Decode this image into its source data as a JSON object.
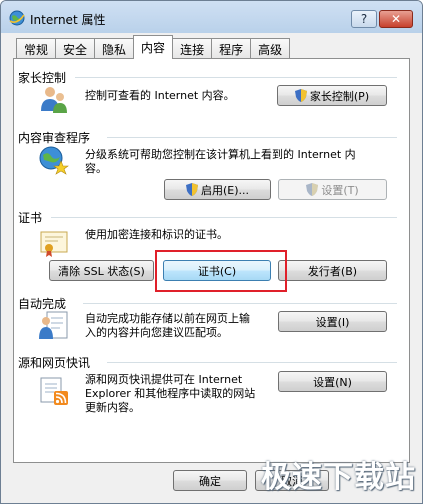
{
  "window": {
    "title": "Internet 属性",
    "help_label": "?",
    "close_label": "✕"
  },
  "tabs": [
    {
      "label": "常规"
    },
    {
      "label": "安全"
    },
    {
      "label": "隐私"
    },
    {
      "label": "内容",
      "active": true
    },
    {
      "label": "连接"
    },
    {
      "label": "程序"
    },
    {
      "label": "高级"
    }
  ],
  "parental": {
    "title": "家长控制",
    "description": "控制可查看的 Internet 内容。",
    "button": "家长控制(P)"
  },
  "advisor": {
    "title": "内容审查程序",
    "description_line1": "分级系统可帮助您控制在该计算机上看到的 Internet 内",
    "description_line2": "容。",
    "enable_button": "启用(E)...",
    "settings_button": "设置(T)"
  },
  "certificates": {
    "title": "证书",
    "description": "使用加密连接和标识的证书。",
    "clear_ssl_button": "清除 SSL 状态(S)",
    "certificates_button": "证书(C)",
    "publishers_button": "发行者(B)"
  },
  "autocomplete": {
    "title": "自动完成",
    "description_line1": "自动完成功能存储以前在网页上输",
    "description_line2": "入的内容并向您建议匹配项。",
    "settings_button": "设置(I)"
  },
  "feeds": {
    "title": "源和网页快讯",
    "description_line1": "源和网页快讯提供可在 Internet",
    "description_line2": "Explorer 和其他程序中读取的网站",
    "description_line3": "更新内容。",
    "settings_button": "设置(N)"
  },
  "footer": {
    "ok_button": "确定",
    "cancel_button": "取消"
  },
  "watermark": "极速下载站",
  "colors": {
    "highlight_box": "#e0202a",
    "focus_button": "#a7d9f5"
  }
}
